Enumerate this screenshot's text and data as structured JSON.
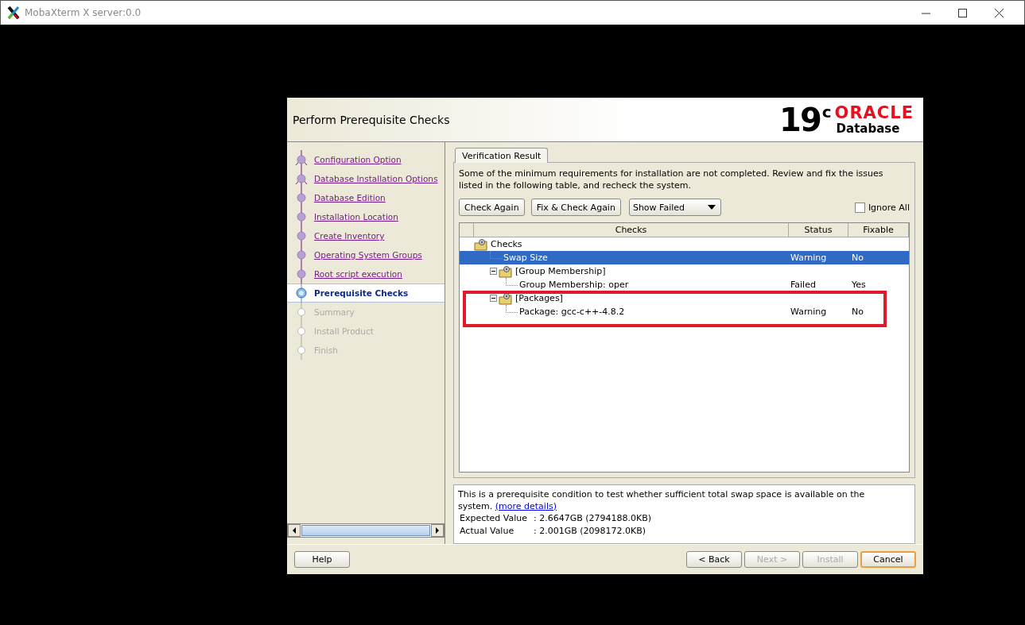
{
  "window": {
    "title": "MobaXterm X server:0.0"
  },
  "dialog": {
    "title": "Perform Prerequisite Checks",
    "logo": {
      "version": "19",
      "version_sup": "c",
      "brand": "ORACLE",
      "product": "Database"
    }
  },
  "steps": [
    {
      "label": "Configuration Option",
      "kind": "done",
      "branch": true
    },
    {
      "label": "Database Installation Options",
      "kind": "done",
      "branch": true
    },
    {
      "label": "Database Edition",
      "kind": "done",
      "branch": false
    },
    {
      "label": "Installation Location",
      "kind": "done",
      "branch": false
    },
    {
      "label": "Create Inventory",
      "kind": "done",
      "branch": false
    },
    {
      "label": "Operating System Groups",
      "kind": "done",
      "branch": false
    },
    {
      "label": "Root script execution",
      "kind": "done",
      "branch": false
    },
    {
      "label": "Prerequisite Checks",
      "kind": "current",
      "branch": false
    },
    {
      "label": "Summary",
      "kind": "pending",
      "branch": false
    },
    {
      "label": "Install Product",
      "kind": "pending",
      "branch": false
    },
    {
      "label": "Finish",
      "kind": "pending",
      "branch": false
    }
  ],
  "tabs": [
    {
      "label": "Verification Result",
      "selected": true
    }
  ],
  "message": "Some of the minimum requirements for installation are not completed. Review and fix the issues listed in the following table, and recheck the system.",
  "toolbar": {
    "buttons": [
      "Check Again",
      "Fix & Check Again"
    ],
    "filter": "Show Failed",
    "ignore_all": {
      "label": "Ignore All",
      "checked": false
    }
  },
  "table": {
    "columns": [
      "",
      "Checks",
      "Status",
      "Fixable"
    ],
    "tree": {
      "label": "Checks",
      "kind": "folder",
      "children": [
        {
          "label": "Swap Size",
          "kind": "item",
          "selected": true,
          "status": "Warning",
          "fixable": "No"
        },
        {
          "label": "[Group Membership]",
          "kind": "folder",
          "expanded": true,
          "highlighted": false,
          "children": [
            {
              "label": "Group Membership: oper",
              "kind": "item",
              "selected": false,
              "status": "Failed",
              "fixable": "Yes"
            }
          ]
        },
        {
          "label": "[Packages]",
          "kind": "folder",
          "expanded": true,
          "highlighted": true,
          "children": [
            {
              "label": "Package: gcc-c++-4.8.2",
              "kind": "item",
              "selected": false,
              "status": "Warning",
              "fixable": "No"
            }
          ]
        }
      ]
    }
  },
  "details": {
    "text": "This is a prerequisite condition to test whether sufficient total swap space is available on the system.",
    "link": "(more details)",
    "rows": [
      {
        "name": "Expected Value",
        "value": ": 2.6647GB (2794188.0KB)"
      },
      {
        "name": "Actual Value",
        "value": ": 2.001GB (2098172.0KB)"
      }
    ]
  },
  "footer": [
    {
      "label": "Help",
      "disabled": false,
      "focused": false
    },
    {
      "label": "< Back",
      "disabled": false,
      "focused": false
    },
    {
      "label": "Next >",
      "disabled": true,
      "focused": false
    },
    {
      "label": "Install",
      "disabled": true,
      "focused": false
    },
    {
      "label": "Cancel",
      "disabled": false,
      "focused": true
    }
  ]
}
